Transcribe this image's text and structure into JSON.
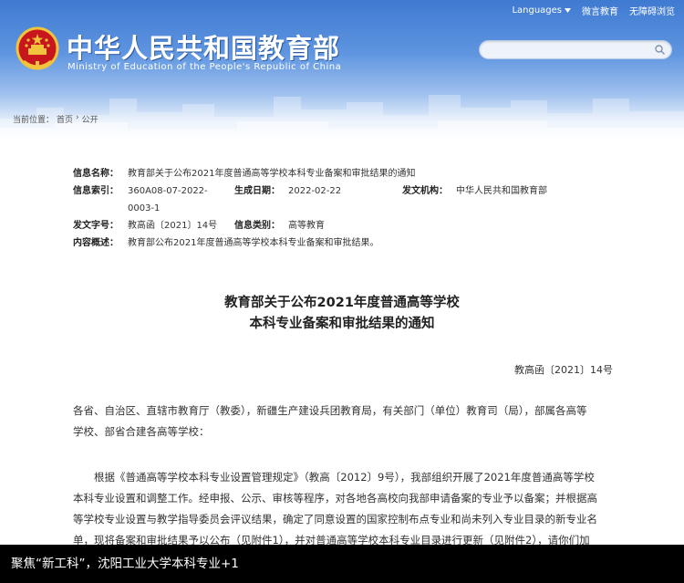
{
  "header": {
    "languages_label": "Languages",
    "wechat_label": "微言教育",
    "accessibility_label": "无障碍浏览",
    "site_title": "中华人民共和国教育部",
    "site_subtitle": "Ministry of Education of the People's Republic of China",
    "search_placeholder": ""
  },
  "breadcrumb": {
    "prefix": "当前位置：",
    "home": "首页",
    "separator": "›",
    "section": "公开"
  },
  "meta": {
    "rows": [
      [
        {
          "label": "信息名称：",
          "value": "教育部关于公布2021年度普通高等学校本科专业备案和审批结果的通知"
        }
      ],
      [
        {
          "label": "信息索引：",
          "value": "360A08-07-2022-"
        },
        {
          "label": "生成日期：",
          "value": "2022-02-22"
        },
        {
          "label": "发文机构：",
          "value": "中华人民共和国教育部"
        }
      ],
      [
        {
          "label": "",
          "value": "0003-1"
        }
      ],
      [
        {
          "label": "发文字号：",
          "value": "教高函〔2021〕14号"
        },
        {
          "label": "信息类别：",
          "value": "高等教育"
        }
      ],
      [
        {
          "label": "内容概述：",
          "value": "教育部公布2021年度普通高等学校本科专业备案和审批结果。"
        }
      ]
    ]
  },
  "document": {
    "title_line1": "教育部关于公布2021年度普通高等学校",
    "title_line2": "本科专业备案和审批结果的通知",
    "number": "教高函〔2021〕14号",
    "addressee_line1": "各省、自治区、直辖市教育厅（教委），新疆生产建设兵团教育局，有关部门（单位）教育司（局），部属各高等",
    "addressee_line2": "学校、部省合建各高等学校：",
    "body_line1": "根据《普通高等学校本科专业设置管理规定》（教高〔2012〕9号），我部组织开展了2021年度普通高等学校",
    "body_line2": "本科专业设置和调整工作。经申报、公示、审核等程序，对各地各高校向我部申请备案的专业予以备案；并根据高",
    "body_line3": "等学校专业设置与教学指导委员会评议结果，确定了同意设置的国家控制布点专业和尚未列入专业目录的新专业名",
    "body_line4": "单，现将备案和审批结果予以公布（见附件1），并对普通高等学校本科专业目录进行更新（见附件2），请你们加"
  },
  "caption": {
    "text": "聚焦“新工科”，沈阳工业大学本科专业+1"
  },
  "colors": {
    "header_blue": "#3f7ad1",
    "caption_background": "#000000"
  },
  "icons": {
    "emblem": "national-emblem-icon",
    "search": "search-icon",
    "dropdown": "caret-down-icon"
  }
}
